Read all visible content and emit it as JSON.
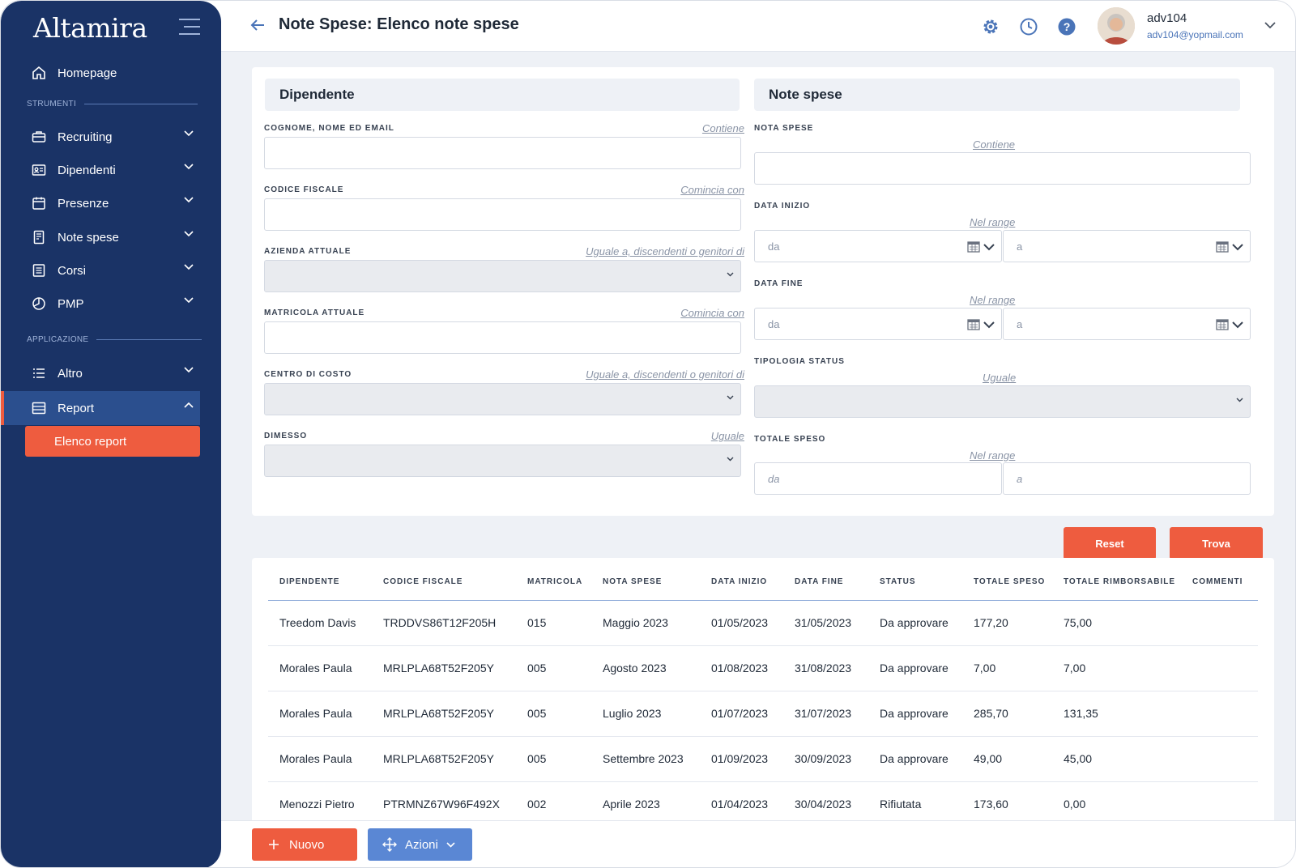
{
  "app": {
    "logo": "Altamira"
  },
  "sidebar": {
    "homepage": "Homepage",
    "section_tools": "STRUMENTI",
    "section_app": "APPLICAZIONE",
    "items": [
      {
        "label": "Recruiting",
        "icon": "briefcase-icon"
      },
      {
        "label": "Dipendenti",
        "icon": "id-card-icon"
      },
      {
        "label": "Presenze",
        "icon": "calendar-icon"
      },
      {
        "label": "Note spese",
        "icon": "receipt-icon"
      },
      {
        "label": "Corsi",
        "icon": "document-icon"
      },
      {
        "label": "PMP",
        "icon": "pie-chart-icon"
      }
    ],
    "altro": "Altro",
    "report": "Report",
    "elenco_report": "Elenco report"
  },
  "header": {
    "title": "Note Spese: Elenco note spese",
    "user_name": "adv104",
    "user_email": "adv104@yopmail.com"
  },
  "filters": {
    "left_title": "Dipendente",
    "right_title": "Note spese",
    "cognome_label": "COGNOME, NOME ED EMAIL",
    "cognome_hint": "Contiene",
    "cf_label": "CODICE FISCALE",
    "cf_hint": "Comincia con",
    "azienda_label": "AZIENDA ATTUALE",
    "azienda_hint": "Uguale a, discendenti o genitori di",
    "matricola_label": "MATRICOLA ATTUALE",
    "matricola_hint": "Comincia con",
    "centro_label": "CENTRO DI COSTO",
    "centro_hint": "Uguale a, discendenti o genitori di",
    "dimesso_label": "DIMESSO",
    "dimesso_hint": "Uguale",
    "nota_label": "NOTA SPESE",
    "nota_hint": "Contiene",
    "inizio_label": "DATA INIZIO",
    "inizio_hint": "Nel range",
    "fine_label": "DATA FINE",
    "fine_hint": "Nel range",
    "status_label": "TIPOLOGIA STATUS",
    "status_hint": "Uguale",
    "totale_label": "TOTALE SPESO",
    "totale_hint": "Nel range",
    "da": "da",
    "a": "a"
  },
  "buttons": {
    "reset": "Reset",
    "trova": "Trova",
    "nuovo": "Nuovo",
    "azioni": "Azioni"
  },
  "table": {
    "headers": [
      "DIPENDENTE",
      "CODICE FISCALE",
      "MATRICOLA",
      "NOTA SPESE",
      "DATA INIZIO",
      "DATA FINE",
      "STATUS",
      "TOTALE SPESO",
      "TOTALE RIMBORSABILE",
      "COMMENTI"
    ],
    "rows": [
      [
        "Treedom Davis",
        "TRDDVS86T12F205H",
        "015",
        "Maggio 2023",
        "01/05/2023",
        "31/05/2023",
        "Da approvare",
        "177,20",
        "75,00",
        ""
      ],
      [
        "Morales Paula",
        "MRLPLA68T52F205Y",
        "005",
        "Agosto 2023",
        "01/08/2023",
        "31/08/2023",
        "Da approvare",
        "7,00",
        "7,00",
        ""
      ],
      [
        "Morales Paula",
        "MRLPLA68T52F205Y",
        "005",
        "Luglio 2023",
        "01/07/2023",
        "31/07/2023",
        "Da approvare",
        "285,70",
        "131,35",
        ""
      ],
      [
        "Morales Paula",
        "MRLPLA68T52F205Y",
        "005",
        "Settembre 2023",
        "01/09/2023",
        "30/09/2023",
        "Da approvare",
        "49,00",
        "45,00",
        ""
      ],
      [
        "Menozzi Pietro",
        "PTRMNZ67W96F492X",
        "002",
        "Aprile 2023",
        "01/04/2023",
        "30/04/2023",
        "Rifiutata",
        "173,60",
        "0,00",
        ""
      ]
    ]
  }
}
